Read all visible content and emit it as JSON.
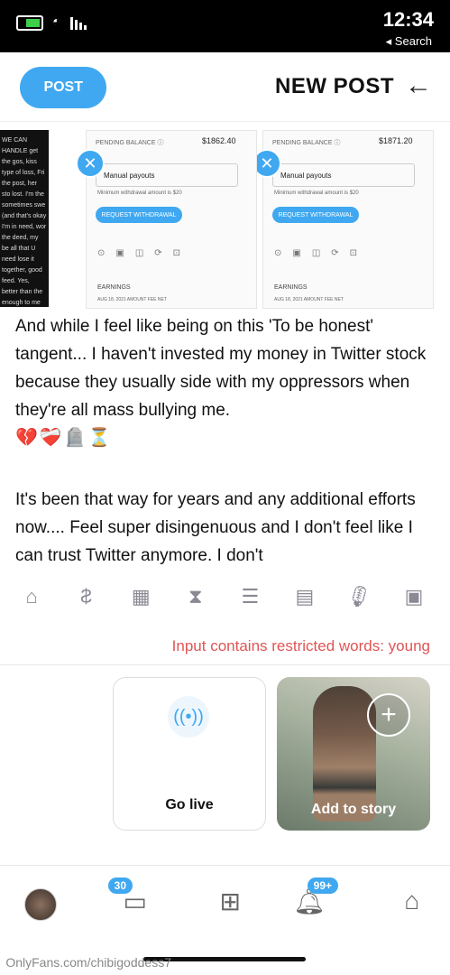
{
  "status_bar": {
    "time": "12:34",
    "back_label": "◂ Search"
  },
  "header": {
    "title": "NEW POST",
    "post_label": "POST"
  },
  "attachments": [
    {
      "pending": "PENDING BALANCE ⓘ",
      "amount": "$1871.20",
      "payout": "Manual payouts",
      "min": "Minimum withdrawal amount is $20",
      "button": "REQUEST WITHDRAWAL",
      "earnings": "EARNINGS",
      "cols": "AUG 18, 2021   AMOUNT   FEE   NET"
    },
    {
      "pending": "PENDING BALANCE ⓘ",
      "amount": "$1862.40",
      "payout": "Manual payouts",
      "min": "Minimum withdrawal amount is $20",
      "button": "REQUEST WITHDRAWAL",
      "earnings": "EARNINGS",
      "cols": "AUG 18, 2021   AMOUNT   FEE   NET"
    }
  ],
  "dark_attachment_text": "WE CAN HANDLE get the gos, kiss type of loss, Fri the post, her sto lost. I'm the sometimes swe (and that's okay I'm in need, wor the deed, my be all that U need lose it together, good feed. Yes, better than the enough to me th",
  "body": {
    "paragraph1": "And while I feel like being on this 'To be honest' tangent... I haven't invested my money in Twitter stock because they usually side with my oppressors when they're all mass bullying me.",
    "emojis1": "💔❤️‍🩹🪦⏳",
    "paragraph2": "It's been that way for years and any additional efforts now.... Feel super disingenuous and I don't feel like I can trust Twitter anymore. I don't"
  },
  "toolbar_icons": [
    "image-icon",
    "microphone-icon",
    "gallery-icon",
    "poll-icon",
    "hourglass-icon",
    "calendar-icon",
    "price-icon",
    "tag-icon"
  ],
  "restricted_message": "Input contains restricted words: young",
  "stories": {
    "add_story": "Add to story",
    "go_live": "Go live"
  },
  "nav": {
    "notifications_badge": "99+",
    "messages_badge": "30"
  },
  "watermark": "OnlyFans.com/chibigoddess7",
  "colors": {
    "accent": "#3fa8f0",
    "error": "#e05555"
  }
}
